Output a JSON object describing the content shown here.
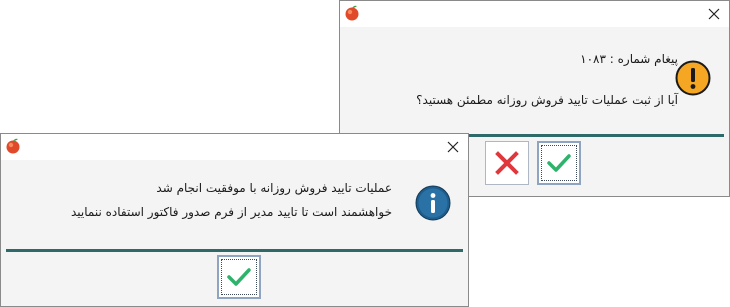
{
  "colors": {
    "divider": "#2e6a6a",
    "ok_check": "#2db36b",
    "cancel_x": "#e0373d",
    "warning_fill": "#f5a623",
    "info_fill": "#1f5e8c"
  },
  "confirm_dialog": {
    "message_number": "پیغام شماره : ۱۰۸۳",
    "question": "آیا از ثبت عملیات تایید فروش روزانه مطمئن هستید؟",
    "icon": "warning-exclamation-icon"
  },
  "info_dialog": {
    "line1": "عملیات تایید فروش روزانه با موفقیت انجام شد",
    "line2": "خواهشمند است تا تایید مدیر از فرم صدور فاکتور استفاده ننمایید",
    "icon": "info-icon"
  }
}
